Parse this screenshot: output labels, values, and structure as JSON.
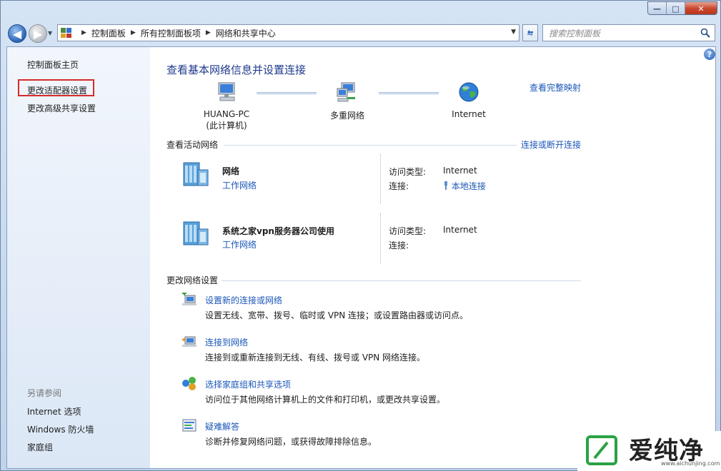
{
  "window": {
    "controls": {
      "minimize": "—",
      "maximize": "□",
      "close": "✕"
    }
  },
  "nav": {
    "back_glyph": "◀",
    "forward_glyph": "▶",
    "breadcrumb": [
      "控制面板",
      "所有控制面板项",
      "网络和共享中心"
    ],
    "search_placeholder": "搜索控制面板"
  },
  "sidebar": {
    "home": "控制面板主页",
    "items": [
      "更改适配器设置",
      "更改高级共享设置"
    ],
    "see_also_label": "另请参阅",
    "see_also": [
      "Internet 选项",
      "Windows 防火墙",
      "家庭组"
    ]
  },
  "main": {
    "help": "?",
    "title": "查看基本网络信息并设置连接",
    "full_map_link": "查看完整映射",
    "map_nodes": [
      {
        "name": "HUANG-PC",
        "sub": "(此计算机)"
      },
      {
        "name": "多重网络",
        "sub": ""
      },
      {
        "name": "Internet",
        "sub": ""
      }
    ],
    "active_networks_heading": "查看活动网络",
    "connect_link": "连接或断开连接",
    "networks": [
      {
        "name": "网络",
        "type": "工作网络",
        "access_label": "访问类型:",
        "access_value": "Internet",
        "conn_label": "连接:",
        "conn_value": "本地连接"
      },
      {
        "name": "系统之家vpn服务器公司使用",
        "type": "工作网络",
        "access_label": "访问类型:",
        "access_value": "Internet",
        "conn_label": "连接:",
        "conn_value": ""
      }
    ],
    "change_settings_heading": "更改网络设置",
    "tasks": [
      {
        "title": "设置新的连接或网络",
        "desc": "设置无线、宽带、拨号、临时或 VPN 连接；或设置路由器或访问点。"
      },
      {
        "title": "连接到网络",
        "desc": "连接到或重新连接到无线、有线、拨号或 VPN 网络连接。"
      },
      {
        "title": "选择家庭组和共享选项",
        "desc": "访问位于其他网络计算机上的文件和打印机，或更改共享设置。"
      },
      {
        "title": "疑难解答",
        "desc": "诊断并修复网络问题，或获得故障排除信息。"
      }
    ]
  },
  "watermark": {
    "brand": "爱纯净",
    "url": "www.aichunjing.com"
  },
  "colors": {
    "link": "#1a56b8",
    "title": "#1e3a8c",
    "highlight_box": "#d62b2b",
    "watermark_green": "#2aa243"
  }
}
